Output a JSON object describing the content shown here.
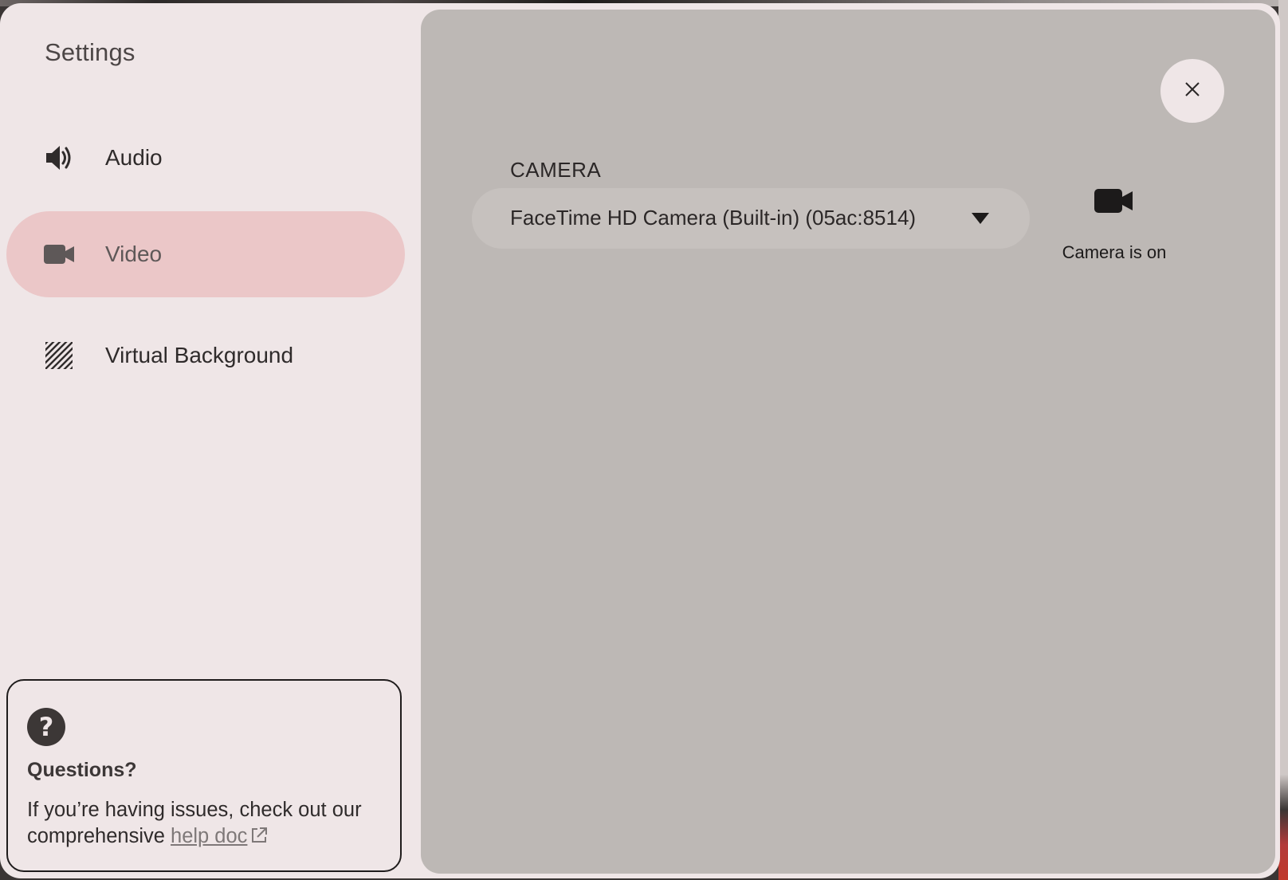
{
  "sidebar": {
    "title": "Settings",
    "items": [
      {
        "label": "Audio",
        "icon": "speaker-icon",
        "active": false
      },
      {
        "label": "Video",
        "icon": "video-camera-icon",
        "active": true
      },
      {
        "label": "Virtual Background",
        "icon": "background-pattern-icon",
        "active": false
      }
    ]
  },
  "help": {
    "icon": "question-icon",
    "title": "Questions?",
    "text": "If you’re having issues, check out our comprehensive",
    "link_label": "help doc",
    "link_icon": "external-link-icon"
  },
  "main": {
    "close_icon": "close-icon",
    "camera": {
      "label": "CAMERA",
      "selected": "FaceTime HD Camera (Built-in) (05ac:8514)",
      "dropdown_icon": "chevron-down-icon"
    },
    "camera_toggle": {
      "icon": "video-camera-icon",
      "status": "Camera is on"
    }
  },
  "colors": {
    "dialog_bg": "#efe6e7",
    "active_nav": "#ebc7c8",
    "panel_bg": "#bdb8b5",
    "select_bg": "#c6c1be"
  }
}
